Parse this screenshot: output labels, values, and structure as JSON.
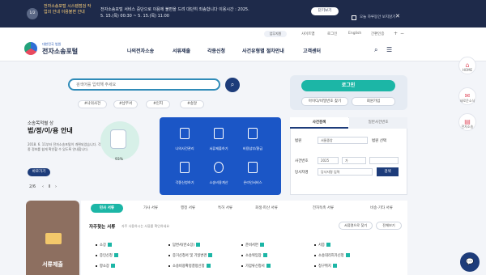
{
  "banner": {
    "badge": "1/2",
    "title": "전자소송포털 시스템점검 작업의 안내 이용불편 안내",
    "body": "전자소송포털 서비스 중단으로 이용에 불편을 드려 대단히 죄송합니다 이용시간 : 2025. 5. 15.(목) 00:30 ~ 5. 15.(목) 11:00",
    "close_label": "닫기보기",
    "today_label": "오늘 하루동안 보지않기",
    "x_icon": "close-icon"
  },
  "header": {
    "util_pill": "업무지원",
    "util_links": [
      "사이트맵",
      "로그인",
      "English",
      "간편인증"
    ],
    "logo_small": "대한민국 법원",
    "logo_big": "전자소송포털",
    "gnb": [
      "나의전자소송",
      "서류제출",
      "각종신청",
      "사건유형별 절차안내",
      "고객센터"
    ],
    "search_icon": "search-icon",
    "menu_icon": "menu-icon"
  },
  "side": [
    {
      "icon": "home-icon",
      "label": "HOME"
    },
    {
      "icon": "notice-icon",
      "label": "새로운소식"
    },
    {
      "icon": "folder-icon",
      "label": "전자소송"
    }
  ],
  "search": {
    "placeholder": "검색어를 입력해 주세요",
    "tags": [
      "#나의사건",
      "#납부서",
      "#인지",
      "#송달"
    ]
  },
  "login": {
    "button": "로그인",
    "find": "아이디/비밀번호 찾기",
    "join": "회원가입"
  },
  "promo": {
    "line1": "소송목적별 상",
    "line2": "법/정/이/용 안내",
    "desc": "2018. 6. 11부터 전자소송포털이 개편되었습니다. 각종 정보를 쉽게 확인할 수 있도록 안내합니다.",
    "more": "바로가기",
    "pager": "2/6",
    "percent": "93%"
  },
  "services": [
    "나의사건관리",
    "서류제출하기",
    "비용납부/환급",
    "각종신청하기",
    "소송비용계산",
    "온라인서비스"
  ],
  "case_search": {
    "tabs": [
      "사건검색",
      "일반사건번호"
    ],
    "court_label": "법원",
    "court_value": "서울중앙",
    "court_check": "법원 선택",
    "year_label": "사건번호",
    "year_value": "2025",
    "type_value": "가",
    "party_label": "당사자명",
    "party_value": "당사자명 입력",
    "submit": "검색"
  },
  "docs": {
    "card_title": "서류제출",
    "tabs": [
      "민사 서류",
      "가사 서류",
      "행정 서류",
      "특허 서류",
      "회생·파산 서류",
      "전자독촉 서류",
      "비송·기타 서류"
    ],
    "faq_title": "자주찾는 서류",
    "faq_note": "자주 사용하시는 서류를 확인하세요",
    "pill1": "서류명으로 찾기",
    "pill2": "전체보기",
    "items": [
      "소장",
      "답변서(반소장)",
      "준비서면",
      "서증",
      "증인신청",
      "증거신청서 및 기일변경",
      "소송위임장",
      "소송대리허가신청",
      "항소장",
      "소송비용확정결정신청",
      "가압류신청서",
      "청구취지"
    ]
  }
}
